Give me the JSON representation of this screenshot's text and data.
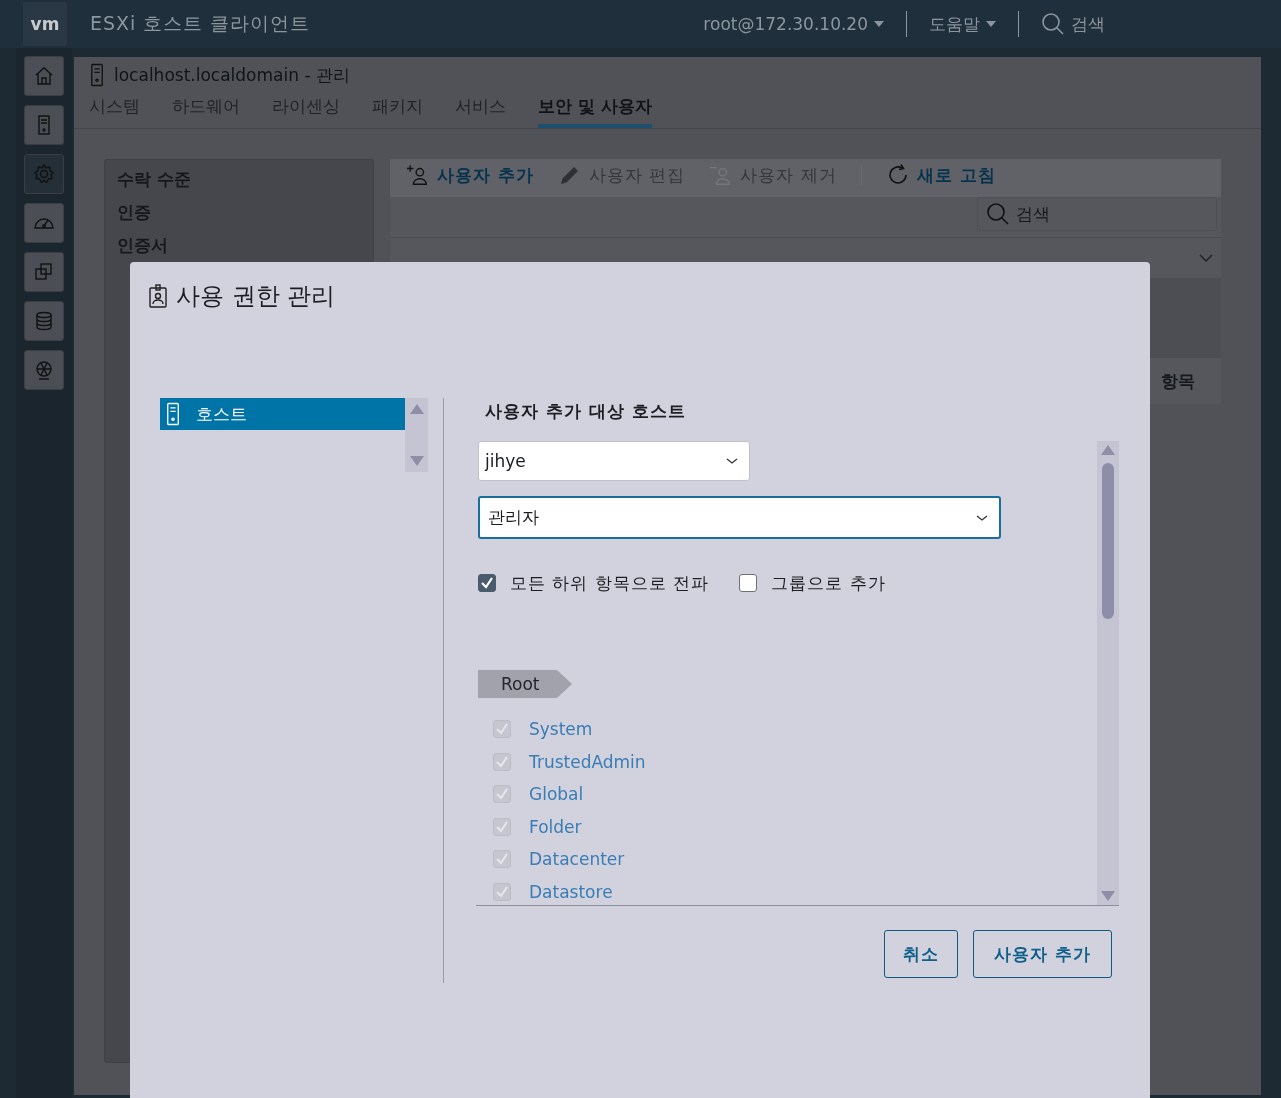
{
  "app": {
    "logo": "vm",
    "title": "ESXi 호스트 클라이언트",
    "user": "root@172.30.10.20",
    "help": "도움말",
    "search": "검색"
  },
  "rail": [
    {
      "kind": "home",
      "selected": false
    },
    {
      "kind": "server",
      "selected": false
    },
    {
      "kind": "gear",
      "selected": true
    },
    {
      "kind": "gauge",
      "selected": false
    },
    {
      "kind": "copies",
      "selected": false
    },
    {
      "kind": "database",
      "selected": false
    },
    {
      "kind": "network",
      "selected": false
    }
  ],
  "page": {
    "title": "localhost.localdomain - 관리",
    "tabs": [
      {
        "label": "시스템",
        "selected": false
      },
      {
        "label": "하드웨어",
        "selected": false
      },
      {
        "label": "라이센싱",
        "selected": false
      },
      {
        "label": "패키지",
        "selected": false
      },
      {
        "label": "서비스",
        "selected": false
      },
      {
        "label": "보안 및 사용자",
        "selected": true
      }
    ]
  },
  "side_menu": [
    {
      "label": "수락 수준",
      "selected": false
    },
    {
      "label": "인증",
      "selected": false
    },
    {
      "label": "인증서",
      "selected": false
    }
  ],
  "toolbar": [
    {
      "kind": "add",
      "label": "사용자 추가",
      "disabled": false
    },
    {
      "kind": "edit",
      "label": "사용자 편집",
      "disabled": true
    },
    {
      "kind": "remove",
      "label": "사용자 제거",
      "disabled": true
    },
    {
      "kind": "refresh",
      "label": "새로 고침",
      "disabled": false
    }
  ],
  "search_field": {
    "placeholder": "검색"
  },
  "table_footer": "항목",
  "dialog": {
    "title": "사용 권한 관리",
    "tree": [
      {
        "label": "호스트",
        "selected": true
      }
    ],
    "heading": "사용자 추가 대상 호스트",
    "user_select": "jihye",
    "role_select": "관리자",
    "options": [
      {
        "label": "모든 하위 항목으로 전파",
        "checked": true
      },
      {
        "label": "그룹으로 추가",
        "checked": false
      }
    ],
    "breadcrumb": "Root",
    "privileges": [
      {
        "label": "System",
        "checked": true,
        "disabled": true
      },
      {
        "label": "TrustedAdmin",
        "checked": true,
        "disabled": true
      },
      {
        "label": "Global",
        "checked": true,
        "disabled": true
      },
      {
        "label": "Folder",
        "checked": true,
        "disabled": true
      },
      {
        "label": "Datacenter",
        "checked": true,
        "disabled": true
      },
      {
        "label": "Datastore",
        "checked": true,
        "disabled": true
      }
    ],
    "buttons": [
      {
        "label": "취소",
        "kind": "cancel"
      },
      {
        "label": "사용자 추가",
        "kind": "confirm"
      }
    ]
  }
}
